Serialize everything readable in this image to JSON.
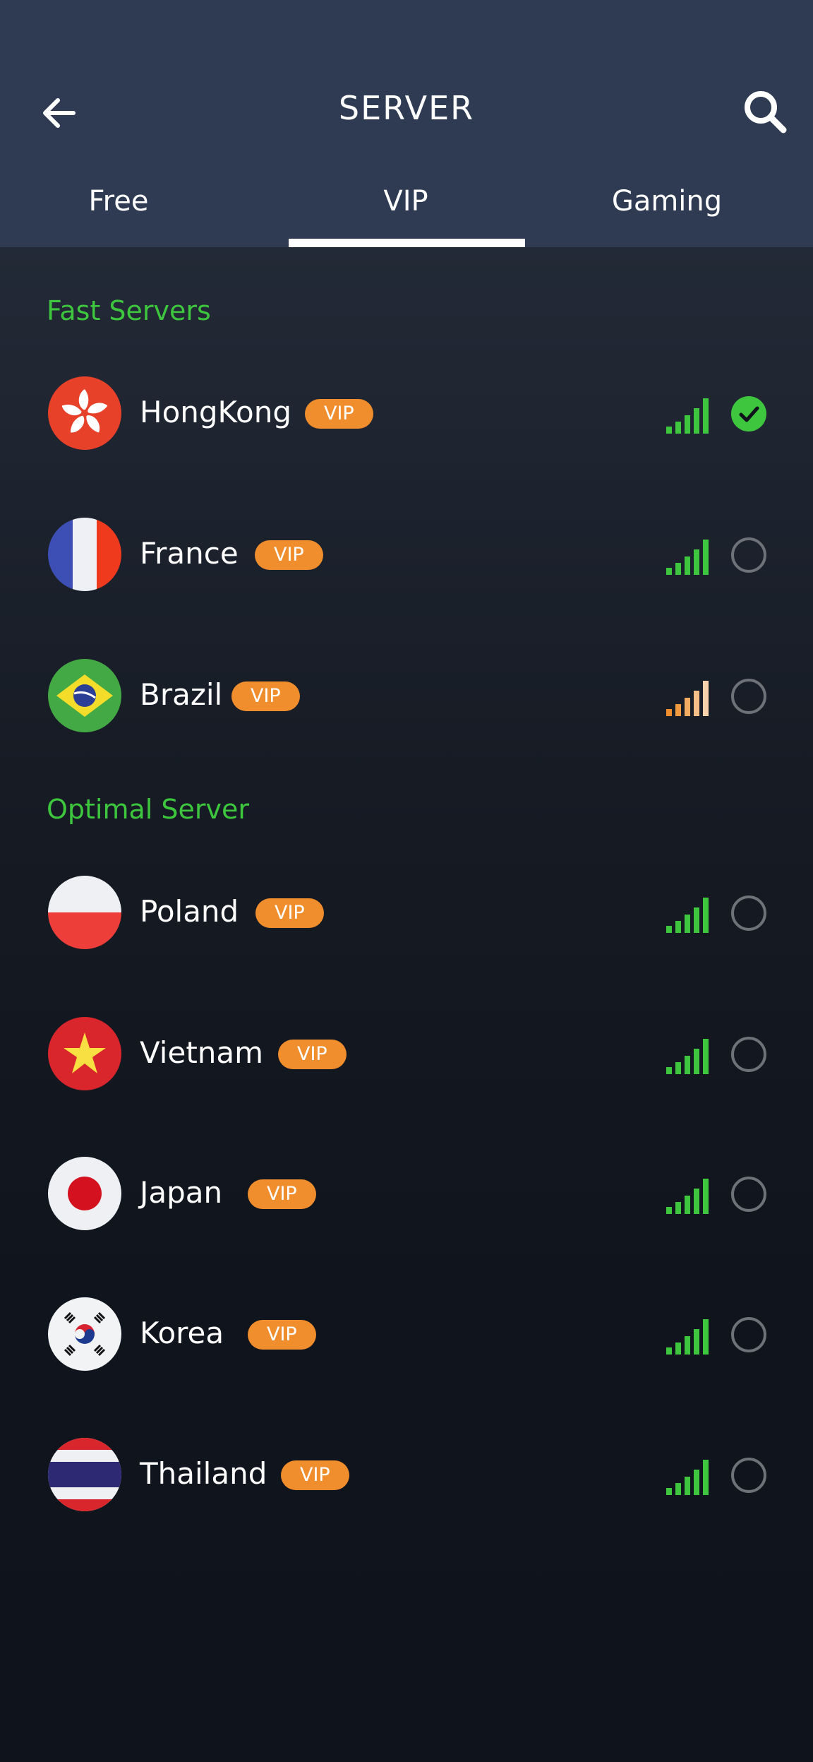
{
  "header": {
    "title": "SERVER",
    "tabs": [
      "Free",
      "VIP",
      "Gaming"
    ],
    "active_tab": "VIP"
  },
  "sections": [
    {
      "title": "Fast Servers",
      "servers": [
        {
          "name": "HongKong",
          "badge": "VIP",
          "signal": "strong",
          "selected": true
        },
        {
          "name": "France",
          "badge": "VIP",
          "signal": "strong",
          "selected": false
        },
        {
          "name": "Brazil",
          "badge": "VIP",
          "signal": "medium",
          "selected": false
        }
      ]
    },
    {
      "title": "Optimal Server",
      "servers": [
        {
          "name": "Poland",
          "badge": "VIP",
          "signal": "strong",
          "selected": false
        },
        {
          "name": "Vietnam",
          "badge": "VIP",
          "signal": "strong",
          "selected": false
        },
        {
          "name": "Japan",
          "badge": "VIP",
          "signal": "strong",
          "selected": false
        },
        {
          "name": "Korea",
          "badge": "VIP",
          "signal": "strong",
          "selected": false
        },
        {
          "name": "Thailand",
          "badge": "VIP",
          "signal": "strong",
          "selected": false
        }
      ]
    }
  ],
  "colors": {
    "header_bg": "#2e3b52",
    "accent_green": "#3ec63e",
    "badge_orange": "#f08d2c",
    "signal_orange": "#f4a460"
  }
}
